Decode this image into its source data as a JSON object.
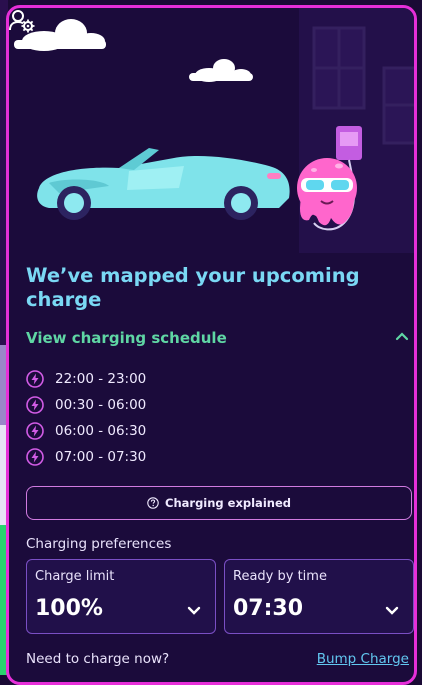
{
  "hero": {
    "title": "We’ve mapped your upcoming charge"
  },
  "schedule": {
    "toggle_label": "View charging schedule",
    "slots": [
      "22:00 - 23:00",
      "00:30 - 06:00",
      "06:00 - 06:30",
      "07:00 - 07:30"
    ]
  },
  "explained_button": {
    "label": "Charging explained"
  },
  "preferences": {
    "title": "Charging preferences",
    "charge_limit": {
      "label": "Charge limit",
      "value": "100%"
    },
    "ready_by": {
      "label": "Ready by time",
      "value": "07:30"
    }
  },
  "footer": {
    "prompt": "Need to charge now?",
    "bump_label": "Bump Charge"
  },
  "colors": {
    "background": "#1b0b3b",
    "border_accent": "#e62fd9",
    "title": "#7ad8f4",
    "schedule_link": "#5fd6a4",
    "bolt_icon": "#d25ce6",
    "bump_link": "#62c7f0"
  },
  "icons": [
    "account-settings-icon",
    "chevron-up-icon",
    "lightning-bolt-icon",
    "question-circle-icon",
    "chevron-down-icon"
  ]
}
